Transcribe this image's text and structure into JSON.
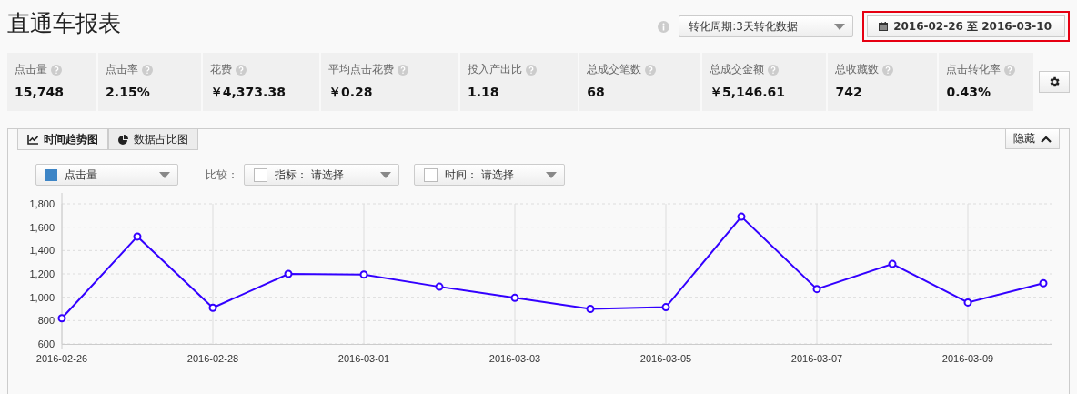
{
  "title": "直通车报表",
  "period_select": {
    "value": "转化周期:3天转化数据"
  },
  "date_range": {
    "value": "2016-02-26 至 2016-03-10",
    "highlighted": true
  },
  "stats": [
    {
      "label": "点击量",
      "value": "15,748"
    },
    {
      "label": "点击率",
      "value": "2.15%"
    },
    {
      "label": "花费",
      "value": "￥4,373.38"
    },
    {
      "label": "平均点击花费",
      "value": "￥0.28"
    },
    {
      "label": "投入产出比",
      "value": "1.18"
    },
    {
      "label": "总成交笔数",
      "value": "68"
    },
    {
      "label": "总成交金额",
      "value": "￥5,146.61"
    },
    {
      "label": "总收藏数",
      "value": "742"
    },
    {
      "label": "点击转化率",
      "value": "0.43%"
    }
  ],
  "tabs": [
    {
      "label": "时间趋势图",
      "kind": "line",
      "selected": true
    },
    {
      "label": "数据占比图",
      "kind": "pie",
      "selected": false
    }
  ],
  "hide_button": "隐藏",
  "metric_select": {
    "value": "点击量",
    "color": "#3d85c6"
  },
  "compare_label": "比较：",
  "compare_selects": [
    {
      "label": "指标：",
      "placeholder": "请选择",
      "checked": false
    },
    {
      "label": "时间：",
      "placeholder": "请选择",
      "checked": false
    }
  ],
  "chart_data": {
    "type": "line",
    "categories": [
      "2016-02-26",
      null,
      "2016-02-28",
      null,
      "2016-03-01",
      null,
      "2016-03-03",
      null,
      "2016-03-05",
      null,
      "2016-03-07",
      null,
      "2016-03-09",
      null
    ],
    "grid": true,
    "series": [
      {
        "color": "#3300ff",
        "marker": "circle",
        "values": [
          820,
          1520,
          910,
          1200,
          1195,
          1090,
          995,
          900,
          915,
          1690,
          1070,
          1285,
          955,
          1120
        ]
      }
    ],
    "ylim": [
      600,
      1800
    ],
    "yticks": [
      {
        "value": 600,
        "label": "600"
      },
      {
        "value": 800,
        "label": "800"
      },
      {
        "value": 1000,
        "label": "1,000"
      },
      {
        "value": 1200,
        "label": "1,200"
      },
      {
        "value": 1400,
        "label": "1,400"
      },
      {
        "value": 1600,
        "label": "1,600"
      },
      {
        "value": 1800,
        "label": "1,800"
      }
    ]
  }
}
